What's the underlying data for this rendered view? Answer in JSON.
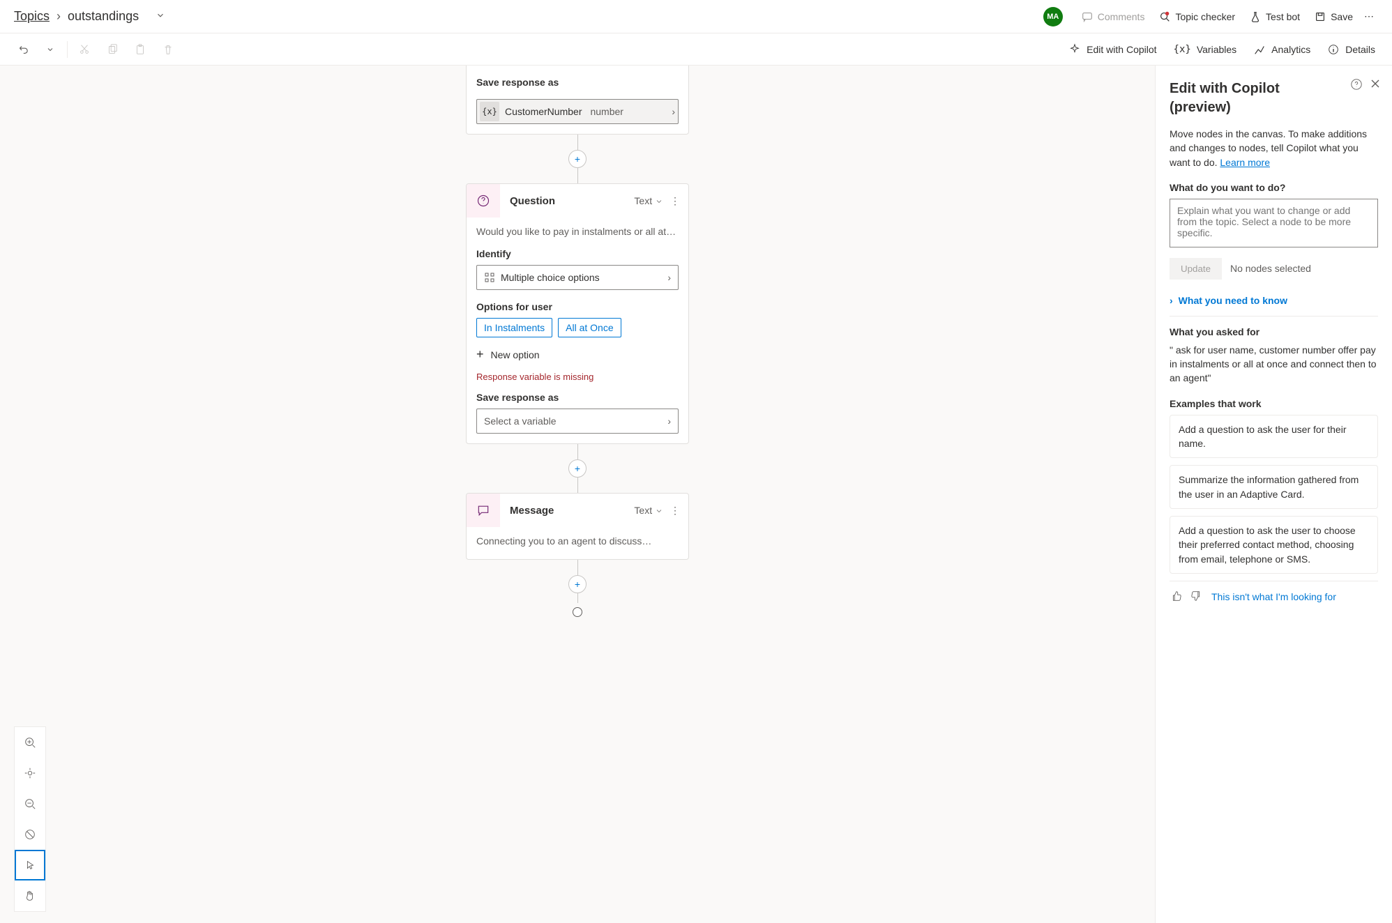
{
  "breadcrumb": {
    "root": "Topics",
    "current": "outstandings"
  },
  "header_actions": {
    "comments": "Comments",
    "topic_checker": "Topic checker",
    "test_bot": "Test bot",
    "save": "Save",
    "avatar": "MA"
  },
  "cmdbar_right": {
    "edit_copilot": "Edit with Copilot",
    "variables": "Variables",
    "analytics": "Analytics",
    "details": "Details"
  },
  "node_save1": {
    "label": "Save response as",
    "var_name": "CustomerNumber",
    "var_type": "number"
  },
  "node_question": {
    "title": "Question",
    "mode": "Text",
    "prompt": "Would you like to pay in instalments or all at…",
    "identify_label": "Identify",
    "identify_value": "Multiple choice options",
    "options_label": "Options for user",
    "options": [
      "In Instalments",
      "All at Once"
    ],
    "new_option": "New option",
    "error": "Response variable is missing",
    "save_label": "Save response as",
    "save_placeholder": "Select a variable"
  },
  "node_message": {
    "title": "Message",
    "mode": "Text",
    "body": "Connecting you to an agent to discuss…"
  },
  "sidepanel": {
    "title": "Edit with Copilot (preview)",
    "intro": "Move nodes in the canvas. To make additions and changes to nodes, tell Copilot what you want to do. ",
    "learn_more": "Learn more",
    "prompt_label": "What do you want to do?",
    "prompt_placeholder": "Explain what you want to change or add from the topic. Select a node to be more specific.",
    "update": "Update",
    "selection_hint": "No nodes selected",
    "accordion": "What you need to know",
    "asked_label": "What you asked for",
    "asked_text": "\" ask for user name, customer number offer pay in instalments or all at once and connect then to an agent\"",
    "examples_label": "Examples that work",
    "examples": [
      "Add a question to ask the user for their name.",
      "Summarize the information gathered from the user in an Adaptive Card.",
      "Add a question to ask the user to choose their preferred contact method, choosing from email, telephone or SMS."
    ],
    "feedback_link": "This isn't what I'm looking for"
  }
}
